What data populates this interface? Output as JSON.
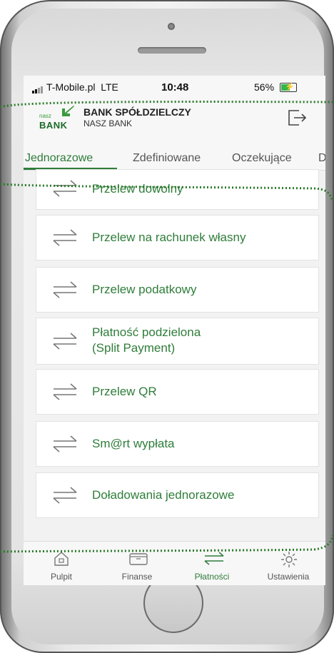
{
  "status_bar": {
    "carrier": "T-Mobile.pl",
    "network": "LTE",
    "time": "10:48",
    "battery": "56%"
  },
  "header": {
    "logo_small": "nasz",
    "logo_big": "BANK",
    "bank_name": "BANK SPÓŁDZIELCZY",
    "bank_subtitle": "NASZ BANK"
  },
  "tabs": [
    {
      "label": "Jednorazowe",
      "active": true
    },
    {
      "label": "Zdefiniowane"
    },
    {
      "label": "Oczekujące"
    },
    {
      "label": "D"
    }
  ],
  "payments": [
    {
      "label": "Przelew dowolny"
    },
    {
      "label": "Przelew na rachunek własny"
    },
    {
      "label": "Przelew podatkowy"
    },
    {
      "label_line1": "Płatność podzielona",
      "label_line2": "(Split Payment)"
    },
    {
      "label": "Przelew QR"
    },
    {
      "label": "Sm@rt wypłata"
    },
    {
      "label": "Doładowania jednorazowe"
    }
  ],
  "bottom_nav": [
    {
      "label": "Pulpit",
      "icon": "home-icon"
    },
    {
      "label": "Finanse",
      "icon": "wallet-icon"
    },
    {
      "label": "Płatności",
      "icon": "transfer-icon",
      "active": true
    },
    {
      "label": "Ustawienia",
      "icon": "gear-icon"
    }
  ],
  "colors": {
    "accent": "#2f7d3a",
    "highlight_dots": "#2a7a2a"
  }
}
